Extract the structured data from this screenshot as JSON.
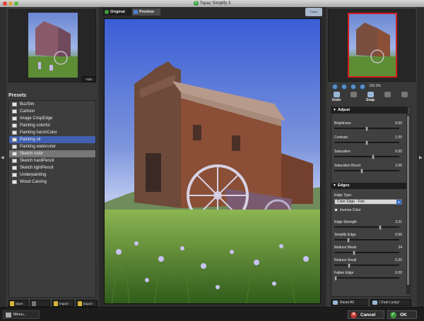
{
  "window": {
    "title": "Topaz Simplify 3",
    "logo_glyph": "S"
  },
  "left": {
    "thumbnail_hide": "Hide",
    "presets_title": "Presets",
    "presets": [
      {
        "label": "BuzSim",
        "state": "normal"
      },
      {
        "label": "Cartoon",
        "state": "normal"
      },
      {
        "label": "Image CrispEdge",
        "state": "normal"
      },
      {
        "label": "Painting colorful",
        "state": "normal"
      },
      {
        "label": "Painting harshColor",
        "state": "normal"
      },
      {
        "label": "Painting oil",
        "state": "selected"
      },
      {
        "label": "Painting watercolor",
        "state": "normal"
      },
      {
        "label": "Sketch color",
        "state": "hover"
      },
      {
        "label": "Sketch hardPencil",
        "state": "normal"
      },
      {
        "label": "Sketch lightPencil",
        "state": "normal"
      },
      {
        "label": "Underpainting",
        "state": "normal"
      },
      {
        "label": "Wood Carving",
        "state": "normal"
      }
    ],
    "buttons": {
      "save": "Save",
      "delete": "",
      "import": "Import",
      "export": "Export"
    }
  },
  "center": {
    "tab_original": "Original",
    "tab_preview": "Preview",
    "active_tab": "Preview",
    "badge": "Topaz"
  },
  "right": {
    "zoom_label": "100.0%",
    "tools": {
      "undo": "Undo",
      "redo": "",
      "snap": "Snap"
    },
    "adjust": {
      "title": "Adjust",
      "sliders": [
        {
          "label": "Brightness",
          "value": "0.00",
          "fraction": 0.5
        },
        {
          "label": "Contrast",
          "value": "1.00",
          "fraction": 0.5
        },
        {
          "label": "Saturation",
          "value": "0.50",
          "fraction": 0.6
        },
        {
          "label": "Saturation Boost",
          "value": "2.06",
          "fraction": 0.42
        }
      ]
    },
    "edges": {
      "title": "Edges",
      "edge_type_label": "Edge Type:",
      "edge_type_value": "Color Edge - Fine",
      "inverse_color": "Inverse Color",
      "sliders": [
        {
          "label": "Edge Strength",
          "value": "3.31",
          "fraction": 0.72
        },
        {
          "label": "Simplify Edge",
          "value": "0.56",
          "fraction": 0.2
        },
        {
          "label": "Reduce Weak",
          "value": "24",
          "fraction": 0.3
        },
        {
          "label": "Reduce Small",
          "value": "0.20",
          "fraction": 0.22
        },
        {
          "label": "Fatten Edge",
          "value": "0.00",
          "fraction": 0.0
        }
      ]
    },
    "reset_all": "Reset All",
    "feel_lucky": "I Feel Lucky!"
  },
  "bottom": {
    "menu": "Menu...",
    "cancel": "Cancel",
    "ok": "OK"
  },
  "colors": {
    "accent_blue": "#4160b0",
    "cancel_red": "#c7362f",
    "ok_green": "#3c9e3a"
  }
}
